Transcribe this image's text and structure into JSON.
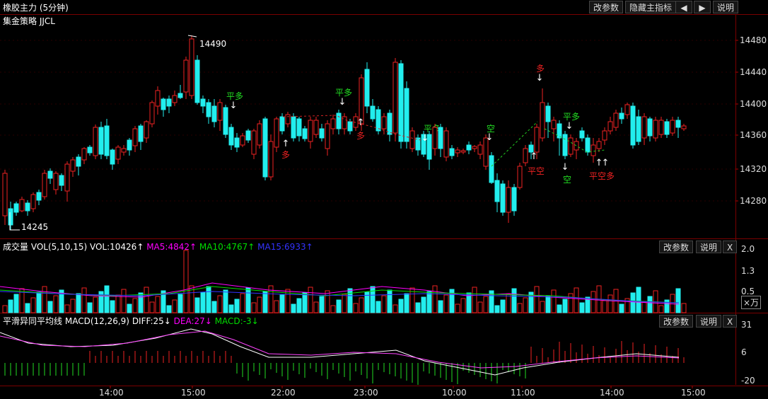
{
  "header": {
    "title": "橡胶主力 (5分钟)",
    "buttons": [
      "改参数",
      "隐藏主指标"
    ],
    "nav_left": "◀",
    "nav_right": "▶",
    "help": "说明"
  },
  "main": {
    "strategy": "集金策略 JJCL",
    "y_ticks": [
      "14480",
      "14440",
      "14400",
      "14360",
      "14320",
      "14280"
    ],
    "high_label": "14490",
    "low_label": "14245",
    "signals": [
      {
        "text": "平多",
        "color": "#22dd22"
      },
      {
        "text": "多",
        "color": "#ee2222"
      },
      {
        "text": "平多",
        "color": "#22dd22"
      },
      {
        "text": "多",
        "color": "#ee2222"
      },
      {
        "text": "平多",
        "color": "#22dd22"
      },
      {
        "text": "空",
        "color": "#22dd22"
      },
      {
        "text": "多",
        "color": "#ee2222"
      },
      {
        "text": "平空",
        "color": "#ee2222"
      },
      {
        "text": "平多",
        "color": "#22dd22"
      },
      {
        "text": "空",
        "color": "#22dd22"
      },
      {
        "text": "平空多",
        "color": "#ee2222"
      }
    ]
  },
  "volume": {
    "label": "成交量",
    "params": "VOL(5,10,15)",
    "vol": "VOL:10426↑",
    "ma5": "MA5:4842↑",
    "ma10": "MA10:4767↑",
    "ma15": "MA15:6933↑",
    "y_ticks": [
      "2.0",
      "1.3",
      "0.5"
    ],
    "unit": "×万",
    "btn_params": "改参数",
    "btn_help": "说明",
    "btn_close": "X",
    "colors": {
      "ma5": "#ff00ff",
      "ma10": "#00dd00",
      "ma15": "#3333ff"
    }
  },
  "macd": {
    "label": "平滑异同平均线",
    "params": "MACD(12,26,9)",
    "diff": "DIFF:25↓",
    "dea": "DEA:27↓",
    "macd": "MACD:-3↓",
    "y_ticks": [
      "31",
      "6",
      "-20"
    ],
    "btn_params": "改参数",
    "btn_help": "说明",
    "btn_close": "X"
  },
  "time_axis": [
    "14:00",
    "15:00",
    "22:00",
    "23:00",
    "10:00",
    "11:00",
    "14:00",
    "15:00"
  ],
  "colors": {
    "up": "#ee2222",
    "down": "#22eeee",
    "grid": "#7a0000",
    "bg": "#000000"
  }
}
